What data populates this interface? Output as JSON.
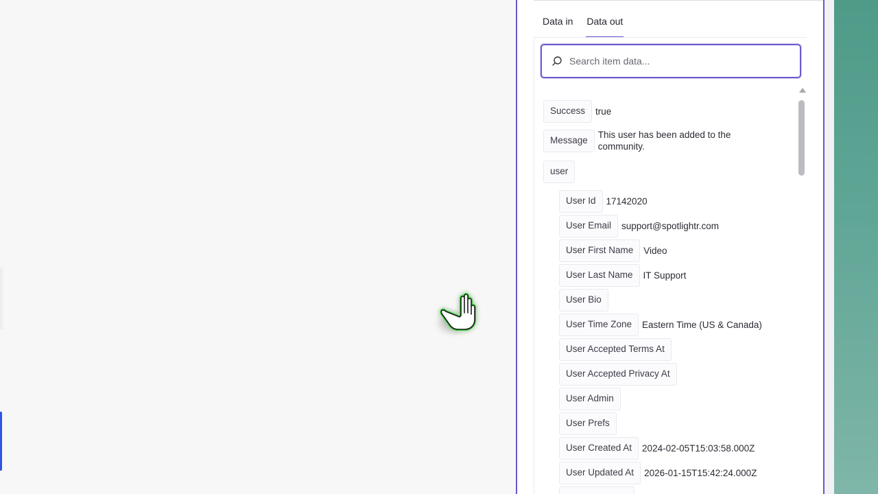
{
  "tabs": [
    {
      "label": "Data in",
      "active": false
    },
    {
      "label": "Data out",
      "active": true
    }
  ],
  "search": {
    "placeholder": "Search item data..."
  },
  "fields": {
    "success": {
      "key": "Success",
      "value": "true"
    },
    "message": {
      "key": "Message",
      "value": "This user has been added to the community."
    },
    "user": {
      "key": "user"
    }
  },
  "user_fields": [
    {
      "key": "User Id",
      "value": "17142020"
    },
    {
      "key": "User Email",
      "value": "support@spotlightr.com"
    },
    {
      "key": "User First Name",
      "value": "Video"
    },
    {
      "key": "User Last Name",
      "value": "IT Support"
    },
    {
      "key": "User Bio",
      "value": ""
    },
    {
      "key": "User Time Zone",
      "value": "Eastern Time (US & Canada)"
    },
    {
      "key": "User Accepted Terms At",
      "value": ""
    },
    {
      "key": "User Accepted Privacy At",
      "value": ""
    },
    {
      "key": "User Admin",
      "value": ""
    },
    {
      "key": "User Prefs",
      "value": ""
    },
    {
      "key": "User Created At",
      "value": "2024-02-05T15:03:58.000Z"
    },
    {
      "key": "User Updated At",
      "value": "2026-01-15T15:42:24.000Z"
    }
  ],
  "colors": {
    "accent": "#6a54c9",
    "cursor_glow": "#2bd12b",
    "side_accent": "#2f57e0",
    "background_green": "#5ea595"
  },
  "icons": {
    "search": "search-icon",
    "cursor": "hand-cursor-icon",
    "scroll_up": "chevron-up-icon"
  }
}
